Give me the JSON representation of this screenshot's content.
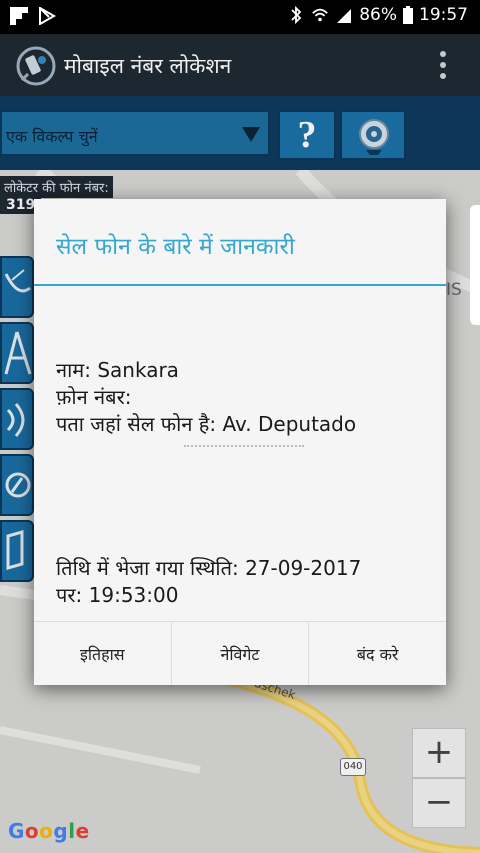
{
  "status_bar": {
    "battery": "86%",
    "time": "19:57"
  },
  "app_bar": {
    "title": "मोबाइल नंबर लोकेशन",
    "logo_icon": "phone-location-icon",
    "menu_icon": "overflow-menu-icon"
  },
  "toolbar": {
    "select_placeholder": "एक विकल्प चुनें",
    "help_label": "?",
    "locate_icon": "radar-locate-icon"
  },
  "map": {
    "locator_label": "लोकेटर की फोन नंबर:",
    "number_fragment": "319",
    "text_fragment": "IS",
    "road_tag": "040",
    "street_fragment": "aschek",
    "zoom_in": "+",
    "zoom_out": "−",
    "attribution": "Google"
  },
  "dialog": {
    "title": "सेल फोन के बारे में जानकारी",
    "name_line": "नाम: Sankara",
    "phone_line": "फ़ोन नंबर:",
    "address_line": "पता जहां सेल फोन है: Av. Deputado",
    "date_line_1": "तिथि में भेजा गया स्थिति: 27-09-2017",
    "date_line_2": "पर: 19:53:00",
    "buttons": {
      "history": "इतिहास",
      "navigate": "नेविगेट",
      "close": "बंद करे"
    }
  },
  "colors": {
    "accent": "#35a7ce",
    "app_bar": "#1f2a33",
    "toolbar": "#0f3a5e",
    "button_blue": "#1b72a8"
  }
}
